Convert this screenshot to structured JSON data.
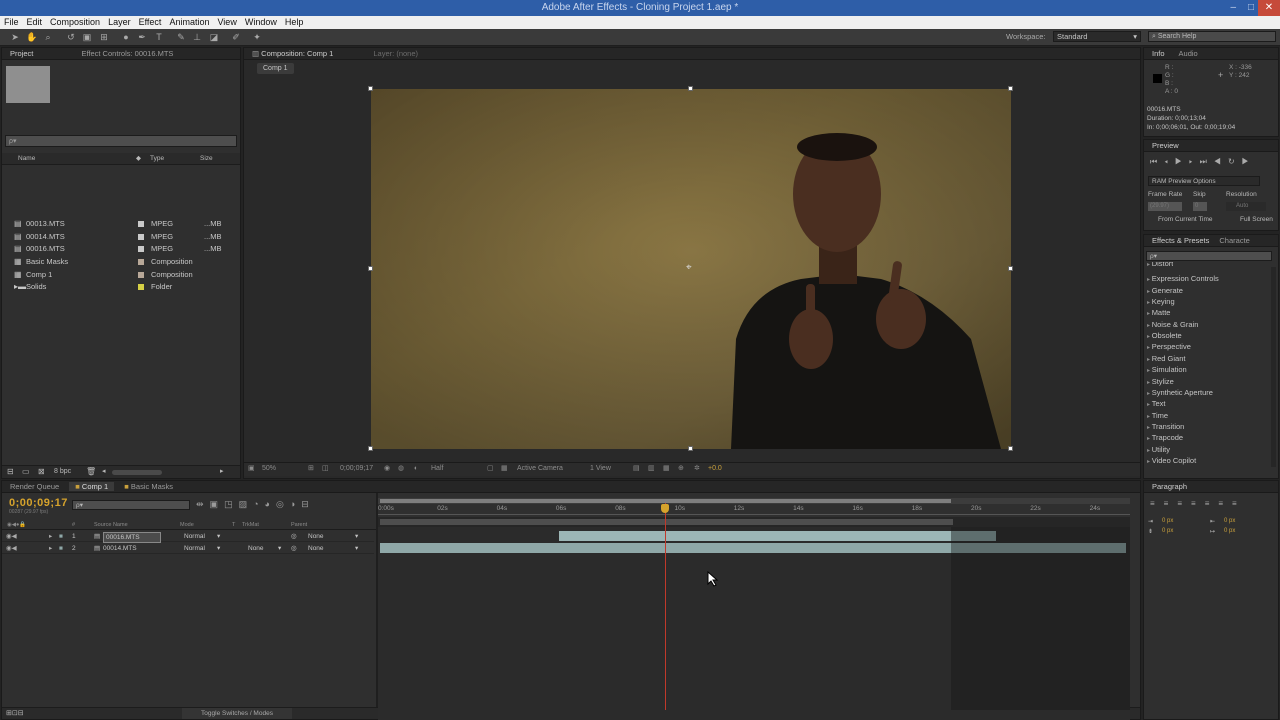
{
  "window": {
    "title": "Adobe After Effects - Cloning Project 1.aep *"
  },
  "menu": [
    "File",
    "Edit",
    "Composition",
    "Layer",
    "Effect",
    "Animation",
    "View",
    "Window",
    "Help"
  ],
  "toolbar": {
    "workspace_label": "Workspace:",
    "workspace_value": "Standard",
    "search_placeholder": "Search Help"
  },
  "project": {
    "tab_project": "Project",
    "tab_effect_controls": "Effect Controls: 00016.MTS",
    "search_placeholder": "ρ▾",
    "columns": {
      "name": "Name",
      "type": "Type",
      "size": "Size"
    },
    "items": [
      {
        "name": "00013.MTS",
        "type": "MPEG",
        "size": "...MB",
        "color": "#c9c9c9"
      },
      {
        "name": "00014.MTS",
        "type": "MPEG",
        "size": "...MB",
        "color": "#c9c9c9"
      },
      {
        "name": "00016.MTS",
        "type": "MPEG",
        "size": "...MB",
        "color": "#c9c9c9"
      },
      {
        "name": "Basic Masks",
        "type": "Composition",
        "size": "",
        "color": "#b8a898"
      },
      {
        "name": "Comp 1",
        "type": "Composition",
        "size": "",
        "color": "#b8a898"
      },
      {
        "name": "Solids",
        "type": "Folder",
        "size": "",
        "color": "#d6d045"
      }
    ],
    "bpc": "8 bpc"
  },
  "composition": {
    "tab_label": "Composition: Comp 1",
    "layer_tab": "Layer: (none)",
    "breadcrumb": "Comp 1",
    "zoom": "50%",
    "timecode": "0;00;09;17",
    "resolution": "Half",
    "camera": "Active Camera",
    "views": "1 View",
    "exposure": "+0.0"
  },
  "info": {
    "tab_info": "Info",
    "tab_audio": "Audio",
    "r": "R :",
    "g": "G :",
    "b": "B :",
    "a": "A : 0",
    "x": "X : -336",
    "y": "Y : 242",
    "file": "00016.MTS",
    "duration": "Duration: 0;00;13;04",
    "inout": "In: 0;00;06;01, Out: 0;00;19;04"
  },
  "preview": {
    "tab": "Preview",
    "ram_options": "RAM Preview Options",
    "frame_rate_label": "Frame Rate",
    "skip_label": "Skip",
    "resolution_label": "Resolution",
    "frame_rate": "(29.97)",
    "skip": "0",
    "resolution": "Auto",
    "from_current": "From Current Time",
    "full_screen": "Full Screen"
  },
  "effects": {
    "tab": "Effects & Presets",
    "tab_char": "Characte",
    "search_placeholder": "ρ▾",
    "items": [
      "Distort",
      "Expression Controls",
      "Generate",
      "Keying",
      "Matte",
      "Noise & Grain",
      "Obsolete",
      "Perspective",
      "Red Giant",
      "Simulation",
      "Stylize",
      "Synthetic Aperture",
      "Text",
      "Time",
      "Transition",
      "Trapcode",
      "Utility",
      "Video Copilot"
    ]
  },
  "paragraph": {
    "tab": "Paragraph",
    "px1": "0 px",
    "px2": "0 px",
    "px3": "0 px",
    "px4": "0 px",
    "px5": "0 px"
  },
  "timeline": {
    "tab_render": "Render Queue",
    "tab_comp1": "Comp 1",
    "tab_masks": "Basic Masks",
    "timecode": "0;00;09;17",
    "timecode_sub": "00287 (29.97 fps)",
    "search_placeholder": "ρ▾",
    "columns": {
      "num": "#",
      "source": "Source Name",
      "mode": "Mode",
      "t": "T",
      "trkmat": "TrkMat",
      "parent": "Parent"
    },
    "layers": [
      {
        "num": "1",
        "name": "00016.MTS",
        "mode": "Normal",
        "trkmat": "",
        "parent": "None"
      },
      {
        "num": "2",
        "name": "00014.MTS",
        "mode": "Normal",
        "trkmat": "None",
        "parent": "None"
      }
    ],
    "ruler": [
      "0:00s",
      "02s",
      "04s",
      "06s",
      "08s",
      "10s",
      "12s",
      "14s",
      "16s",
      "18s",
      "20s",
      "22s",
      "24s"
    ],
    "toggle": "Toggle Switches / Modes"
  }
}
